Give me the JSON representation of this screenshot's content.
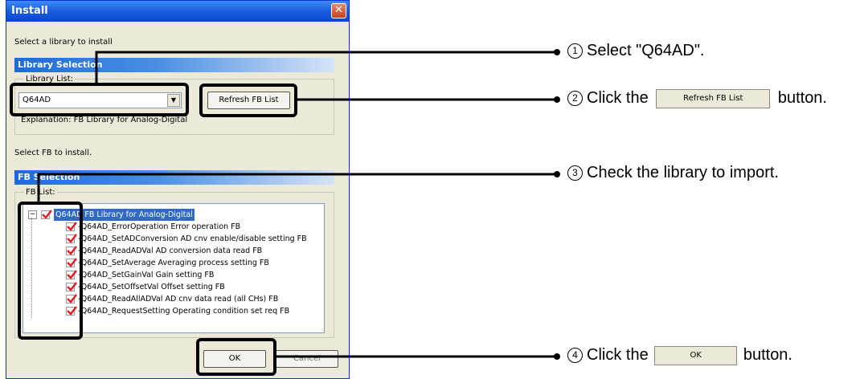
{
  "window": {
    "title": "Install",
    "close_glyph": "✕"
  },
  "prompt_library": "Select a library to install",
  "library_section": {
    "title": "Library Selection",
    "list_label": "Library List:"
  },
  "library_select": {
    "value": "Q64AD",
    "arrow": "▼"
  },
  "refresh_button": {
    "label": "Refresh FB List"
  },
  "explanation": {
    "label": "Explanation:",
    "value": "FB Library for Analog-Digital"
  },
  "prompt_fb": "Select FB to install.",
  "fb_section": {
    "title": "FB Selection",
    "list_label": "FB List:"
  },
  "tree": {
    "expander": "−",
    "root": "Q64AD FB Library for Analog-Digital",
    "items": [
      "-Q64AD_ErrorOperation Error operation FB",
      "-Q64AD_SetADConversion AD cnv enable/disable setting FB",
      "-Q64AD_ReadADVal AD conversion data read FB",
      "-Q64AD_SetAverage Averaging process setting FB",
      "-Q64AD_SetGainVal Gain setting FB",
      "-Q64AD_SetOffsetVal Offset setting FB",
      "-Q64AD_ReadAllADVal AD cnv data read (all CHs) FB",
      "-Q64AD_RequestSetting Operating condition set req FB"
    ]
  },
  "ok_button": {
    "label": "OK"
  },
  "cancel_button": {
    "label": "Cancel"
  },
  "callouts": [
    {
      "num": "1",
      "text": "Select \"Q64AD\"."
    },
    {
      "num": "2",
      "text_before": "Click the",
      "button": "Refresh FB List",
      "text_after": "button."
    },
    {
      "num": "3",
      "text": "Check the library to import."
    },
    {
      "num": "4",
      "text_before": "Click the",
      "button": "OK",
      "text_after": "button."
    }
  ]
}
